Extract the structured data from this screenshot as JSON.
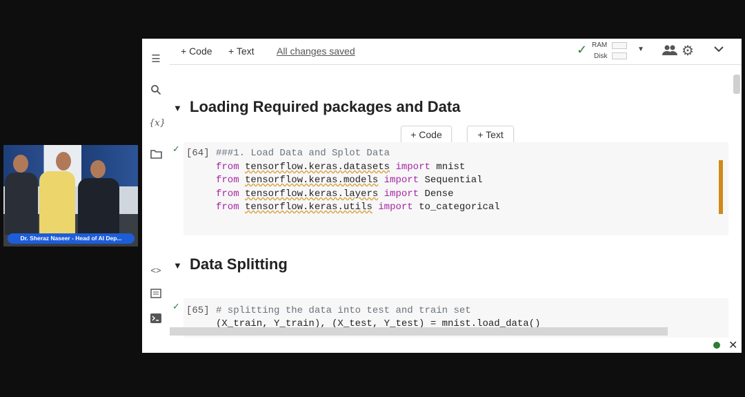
{
  "video": {
    "caption": "Dr. Sheraz Naseer - Head of AI Dep..."
  },
  "toolbar": {
    "add_code": "+ Code",
    "add_text": "+ Text",
    "saved_status": "All changes saved",
    "ram_label": "RAM",
    "disk_label": "Disk"
  },
  "notebook": {
    "section1": "Loading Required packages and Data",
    "section2": "Data Splitting",
    "insert_code": "+ Code",
    "insert_text": "+ Text",
    "cell1": {
      "exec_count": "[64]",
      "lines": [
        "###1. Load Data and Splot Data",
        "from tensorflow.keras.datasets import mnist",
        "from tensorflow.keras.models import Sequential",
        "from tensorflow.keras.layers import Dense",
        "from tensorflow.keras.utils import to_categorical"
      ]
    },
    "cell2": {
      "exec_count": "[65]",
      "lines": [
        "# splitting the data into test and train set",
        "(X_train, Y_train), (X_test, Y_test) = mnist.load_data()"
      ]
    }
  },
  "colors": {
    "keyword": "#a626a4",
    "comment": "#6a737d",
    "check": "#2e7d32",
    "focus_bar": "#d08a18",
    "status_dot": "#2e7d32",
    "caption_bg": "#1d5dd8"
  },
  "icons": [
    "menu-icon",
    "search-icon",
    "variables-icon",
    "folder-icon",
    "code-snippets-icon",
    "command-palette-icon",
    "terminal-icon",
    "check-icon",
    "caret-down-icon",
    "people-icon",
    "gear-icon",
    "chevron-down-icon",
    "close-icon"
  ]
}
